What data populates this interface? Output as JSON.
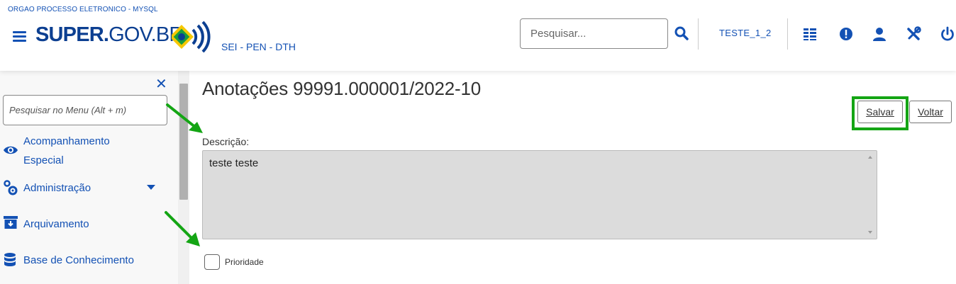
{
  "header": {
    "org_name": "ORGAO PROCESSO ELETRONICO - MYSQL",
    "logo_text_bold": "SUPER.",
    "logo_text_light": "GOV.BR",
    "subtitle": "SEI - PEN - DTH",
    "search_placeholder": "Pesquisar...",
    "user": "TESTE_1_2",
    "icons": [
      "menu-icon",
      "search-icon",
      "list-icon",
      "alert-icon",
      "user-icon",
      "tools-icon",
      "power-icon"
    ],
    "brand_color": "#1351b4"
  },
  "sidebar": {
    "search_placeholder": "Pesquisar no Menu (Alt + m)",
    "items": [
      {
        "label_line1": "Acompanhamento",
        "label_line2": "Especial",
        "icon": "eye-icon"
      },
      {
        "label": "Administração",
        "icon": "gears-icon",
        "has_submenu": true
      },
      {
        "label": "Arquivamento",
        "icon": "archive-icon"
      },
      {
        "label": "Base de Conhecimento",
        "icon": "database-icon"
      }
    ]
  },
  "main": {
    "title": "Anotações 99991.000001/2022-10",
    "save_label": "Salvar",
    "back_label": "Voltar",
    "description_label": "Descrição:",
    "description_value": "teste teste",
    "priority_label": "Prioridade",
    "priority_checked": false
  },
  "annotation_color": "#14a514"
}
